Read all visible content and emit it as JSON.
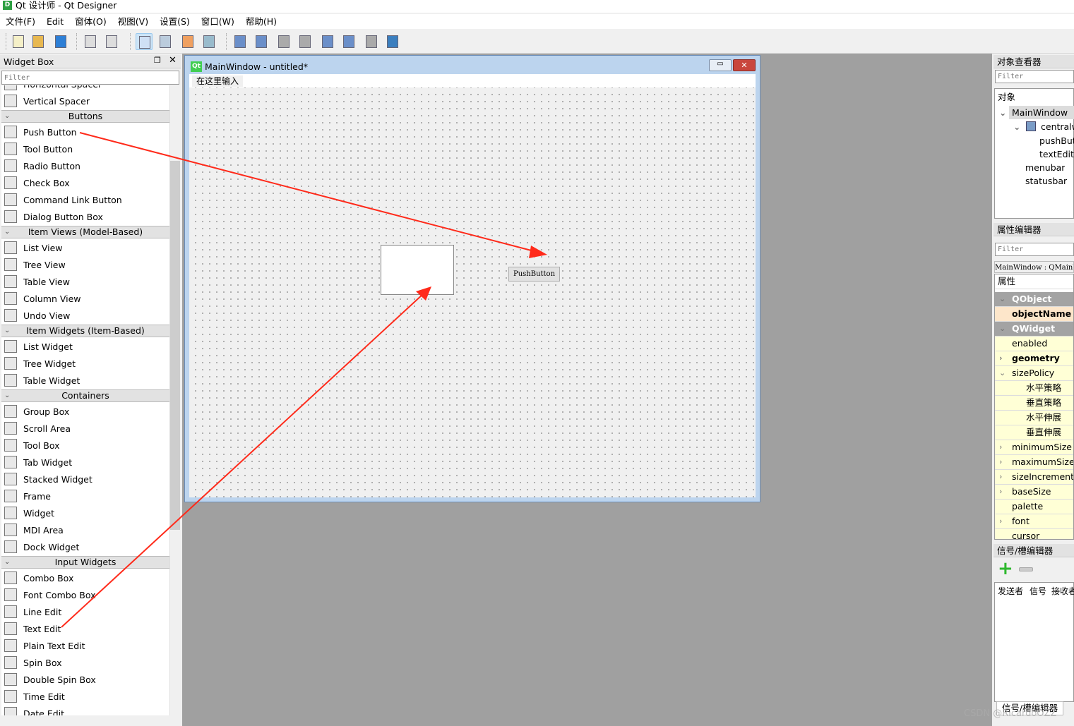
{
  "window": {
    "title": "Qt 设计师 - Qt Designer",
    "icon_letter": "D"
  },
  "menubar": [
    "文件(F)",
    "Edit",
    "窗体(O)",
    "视图(V)",
    "设置(S)",
    "窗口(W)",
    "帮助(H)"
  ],
  "toolbar": [
    "new-file-icon",
    "open-folder-icon",
    "save-icon",
    "copy-disabled-icon",
    "paste-disabled-icon",
    "edit-widgets-icon",
    "edit-signals-slots-icon",
    "edit-buddies-icon",
    "edit-tab-order-icon",
    "layout-horizontal-icon",
    "layout-vertical-icon",
    "layout-h-splitter-icon",
    "layout-v-splitter-icon",
    "layout-grid-icon",
    "layout-form-icon",
    "break-layout-icon",
    "adjust-size-icon"
  ],
  "widget_box": {
    "title": "Widget Box",
    "filter_placeholder": "Filter",
    "sections": [
      {
        "category": null,
        "items": [
          "Horizontal Spacer",
          "Vertical Spacer"
        ]
      },
      {
        "category": "Buttons",
        "items": [
          "Push Button",
          "Tool Button",
          "Radio Button",
          "Check Box",
          "Command Link Button",
          "Dialog Button Box"
        ]
      },
      {
        "category": "Item Views (Model-Based)",
        "items": [
          "List View",
          "Tree View",
          "Table View",
          "Column View",
          "Undo View"
        ]
      },
      {
        "category": "Item Widgets (Item-Based)",
        "items": [
          "List Widget",
          "Tree Widget",
          "Table Widget"
        ]
      },
      {
        "category": "Containers",
        "items": [
          "Group Box",
          "Scroll Area",
          "Tool Box",
          "Tab Widget",
          "Stacked Widget",
          "Frame",
          "Widget",
          "MDI Area",
          "Dock Widget"
        ]
      },
      {
        "category": "Input Widgets",
        "items": [
          "Combo Box",
          "Font Combo Box",
          "Line Edit",
          "Text Edit",
          "Plain Text Edit",
          "Spin Box",
          "Double Spin Box",
          "Time Edit",
          "Date Edit"
        ]
      }
    ]
  },
  "form": {
    "title": "MainWindow - untitled*",
    "qt_badge": "Qt",
    "menu_placeholder": "在这里输入",
    "push_button_label": "PushButton"
  },
  "object_inspector": {
    "title": "对象查看器",
    "filter_placeholder": "Filter",
    "column": "对象",
    "tree": [
      "MainWindow",
      "centralwidget",
      "pushButton",
      "textEdit",
      "menubar",
      "statusbar"
    ]
  },
  "property_editor": {
    "title": "属性编辑器",
    "filter_placeholder": "Filter",
    "class_line": "MainWindow : QMainWindow",
    "column": "属性",
    "rows": [
      "QObject",
      "objectName",
      "QWidget",
      "enabled",
      "geometry",
      "sizePolicy",
      "水平策略",
      "垂直策略",
      "水平伸展",
      "垂直伸展",
      "minimumSize",
      "maximumSize",
      "sizeIncrement",
      "baseSize",
      "palette",
      "font",
      "cursor"
    ]
  },
  "signal_slot_editor": {
    "title": "信号/槽编辑器",
    "columns": [
      "发送者",
      "信号",
      "接收者"
    ],
    "tab": "信号/槽编辑器"
  },
  "watermark": "CSDN @RicardoOZZ",
  "colors": {
    "arrow": "#ff2a1a",
    "mdi_background": "#a0a0a0",
    "property_category": "#a3a3a3",
    "property_row": "#ffffd6"
  }
}
